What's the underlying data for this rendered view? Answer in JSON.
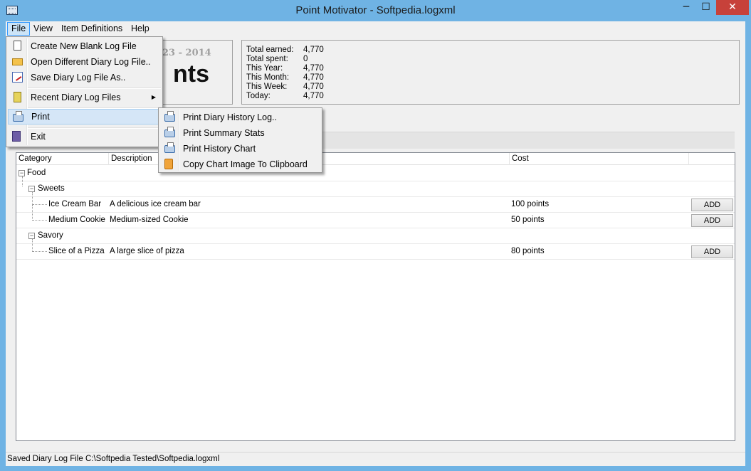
{
  "window": {
    "title": "Point Motivator - Softpedia.logxml"
  },
  "title_buttons": {
    "minimize": "─",
    "maximize": "☐",
    "close": "✕"
  },
  "menubar": {
    "file": "File",
    "view": "View",
    "item_definitions": "Item Definitions",
    "help": "Help"
  },
  "summary": {
    "date_text": "23 - 2014",
    "big_text": "nts",
    "stats": [
      {
        "label": "Total earned:",
        "value": "4,770"
      },
      {
        "label": "Total spent:",
        "value": "0"
      },
      {
        "label": "This Year:",
        "value": "4,770"
      },
      {
        "label": "This Month:",
        "value": "4,770"
      },
      {
        "label": "This Week:",
        "value": "4,770"
      },
      {
        "label": "Today:",
        "value": "4,770"
      }
    ]
  },
  "grid": {
    "columns": [
      "Category",
      "Description",
      "Cost"
    ],
    "rows": [
      {
        "category": "Food"
      },
      {
        "category": "Sweets"
      },
      {
        "name": "Ice Cream Bar",
        "description": "A delicious ice cream bar",
        "cost": "100 points",
        "action": "ADD"
      },
      {
        "name": "Medium Cookie",
        "description": "Medium-sized Cookie",
        "cost": "50 points",
        "action": "ADD"
      },
      {
        "category": "Savory"
      },
      {
        "name": "Slice of a Pizza",
        "description": "A large slice of pizza",
        "cost": "80 points",
        "action": "ADD"
      }
    ]
  },
  "file_menu": {
    "items": [
      {
        "label": "Create New Blank Log File"
      },
      {
        "label": "Open Different Diary Log File.."
      },
      {
        "label": "Save Diary Log File As.."
      },
      {
        "label": "Recent Diary Log Files"
      },
      {
        "label": "Print"
      },
      {
        "label": "Exit"
      }
    ]
  },
  "print_menu": {
    "items": [
      {
        "label": "Print Diary History Log.."
      },
      {
        "label": "Print Summary Stats"
      },
      {
        "label": "Print History Chart"
      },
      {
        "label": "Copy Chart Image To Clipboard"
      }
    ]
  },
  "status": {
    "text": "Saved Diary Log File C:\\Softpedia Tested\\Softpedia.logxml"
  },
  "icons": {
    "app": "app-window-icon",
    "new_file": "blank-page-icon",
    "open": "open-folder-icon",
    "save_as": "save-as-icon",
    "recent": "recent-files-icon",
    "print": "printer-icon",
    "exit": "exit-door-icon",
    "clipboard": "clipboard-icon"
  }
}
